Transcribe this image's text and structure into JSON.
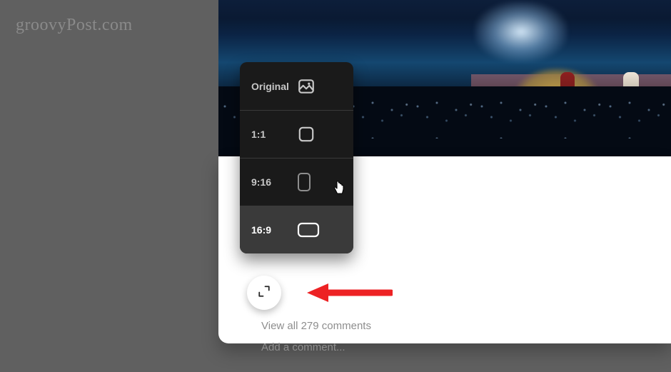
{
  "watermark": "groovyPost.com",
  "menu": {
    "original": "Original",
    "r1_1": "1:1",
    "r9_16": "9:16",
    "r16_9": "16:9"
  },
  "comments": {
    "viewAll": "View all 279 comments",
    "add": "Add a comment..."
  }
}
